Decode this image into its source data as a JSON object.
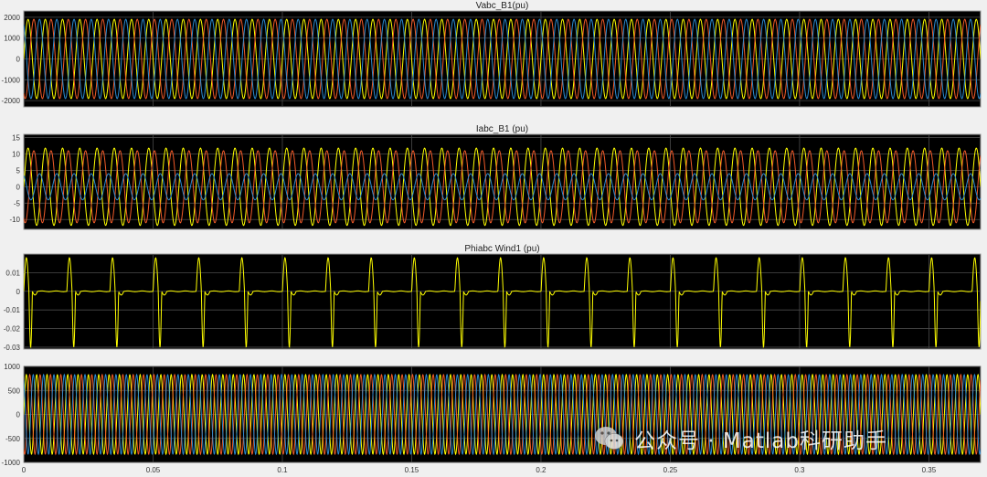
{
  "window": {
    "background": "#f0f0f0",
    "axes_background": "#000000",
    "grid_color": "#4a4a4a"
  },
  "colors": {
    "phase_a": "#ffff00",
    "phase_b": "#f05a28",
    "phase_c": "#2a8ad0"
  },
  "watermark": {
    "text": "公众号 · Matlab科研助手",
    "icon": "wechat-icon"
  },
  "chart_data": [
    {
      "type": "line",
      "title": "Vabc_B1(pu)",
      "xlim": [
        0,
        0.37
      ],
      "ylim": [
        -2300,
        2300
      ],
      "yticks": [
        "2000",
        "1000",
        "0",
        "-1000",
        "-2000"
      ],
      "ytick_values": [
        2000,
        1000,
        0,
        -1000,
        -2000
      ],
      "grid": true,
      "series": [
        {
          "color": "#ffff00",
          "waveform": "sine",
          "amplitude": 1900,
          "frequency_hz": 150,
          "phase_deg": 0
        },
        {
          "color": "#f05a28",
          "waveform": "sine",
          "amplitude": 1900,
          "frequency_hz": 150,
          "phase_deg": -120
        },
        {
          "color": "#2a8ad0",
          "waveform": "sine",
          "amplitude": 1900,
          "frequency_hz": 150,
          "phase_deg": 120
        }
      ]
    },
    {
      "type": "line",
      "title": "Iabc_B1 (pu)",
      "xlim": [
        0,
        0.37
      ],
      "ylim": [
        -13,
        16
      ],
      "yticks": [
        "15",
        "10",
        "5",
        "0",
        "-5",
        "-10"
      ],
      "ytick_values": [
        15,
        10,
        5,
        0,
        -5,
        -10
      ],
      "grid": true,
      "series": [
        {
          "color": "#ffff00",
          "waveform": "sine",
          "amplitude": 11.8,
          "frequency_hz": 150,
          "phase_deg": 0
        },
        {
          "color": "#f05a28",
          "waveform": "sine",
          "amplitude": 11,
          "frequency_hz": 150,
          "phase_deg": -120
        },
        {
          "color": "#2a8ad0",
          "waveform": "sine",
          "amplitude": 4,
          "frequency_hz": 150,
          "phase_deg": 120
        }
      ]
    },
    {
      "type": "line",
      "title": "Phiabc Wind1 (pu)",
      "xlim": [
        0,
        0.37
      ],
      "ylim": [
        -0.031,
        0.02
      ],
      "yticks": [
        "0.01",
        "0",
        "-0.01",
        "-0.02",
        "-0.03"
      ],
      "ytick_values": [
        0.01,
        0,
        -0.01,
        -0.02,
        -0.03
      ],
      "grid": true,
      "series": [
        {
          "color": "#ffff00",
          "waveform": "pulse",
          "period_s": 0.01667,
          "positive_peak": 0.018,
          "negative_peak": -0.03
        }
      ]
    },
    {
      "type": "line",
      "title": "",
      "xlim": [
        0,
        0.37
      ],
      "ylim": [
        -1000,
        1000
      ],
      "yticks": [
        "1000",
        "500",
        "0",
        "-500",
        "-1000"
      ],
      "ytick_values": [
        1000,
        500,
        0,
        -500,
        -1000
      ],
      "xticks": [
        "0",
        "0.05",
        "0.1",
        "0.15",
        "0.2",
        "0.25",
        "0.3",
        "0.35"
      ],
      "xtick_values": [
        0,
        0.05,
        0.1,
        0.15,
        0.2,
        0.25,
        0.3,
        0.35
      ],
      "grid": true,
      "series": [
        {
          "color": "#ffff00",
          "waveform": "sine",
          "amplitude": 830,
          "frequency_hz": 250,
          "phase_deg": 0
        },
        {
          "color": "#f05a28",
          "waveform": "sine",
          "amplitude": 830,
          "frequency_hz": 250,
          "phase_deg": -120
        },
        {
          "color": "#2a8ad0",
          "waveform": "sine",
          "amplitude": 830,
          "frequency_hz": 250,
          "phase_deg": 120
        }
      ]
    }
  ]
}
